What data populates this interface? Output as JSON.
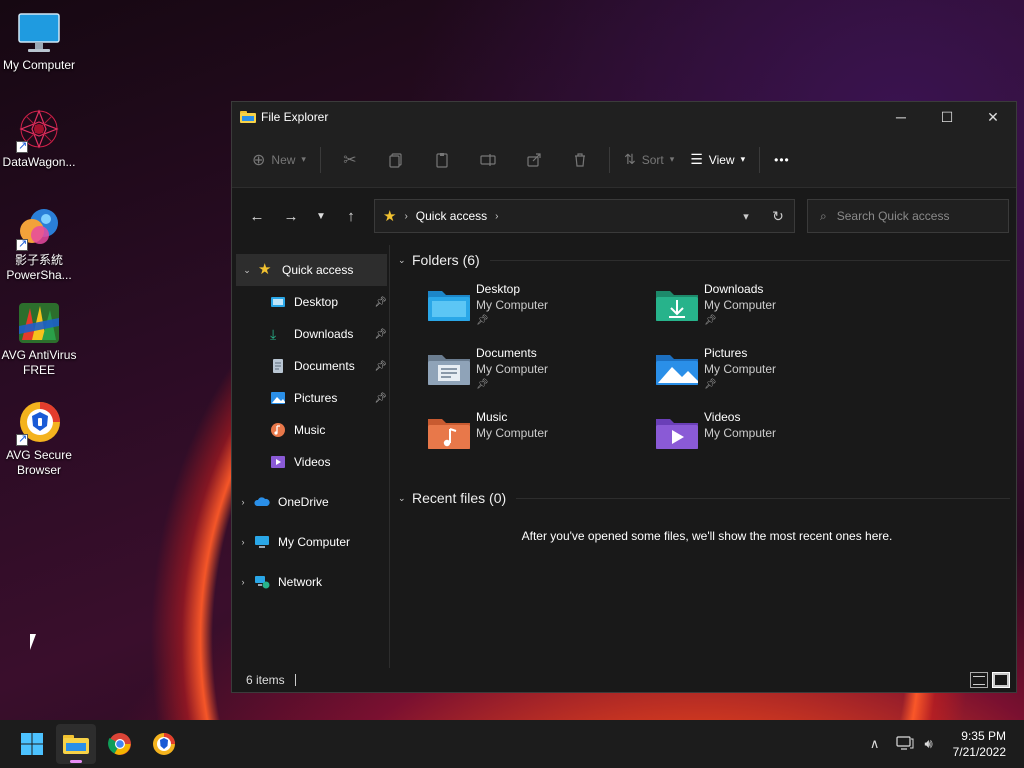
{
  "desktop": {
    "icons": [
      {
        "label": "My Computer",
        "icon": "monitor-icon"
      },
      {
        "label": "DataWagon...",
        "icon": "datawagon-icon"
      },
      {
        "label": "影子系統 PowerSha...",
        "icon": "powershadow-icon"
      },
      {
        "label": "AVG AntiVirus FREE",
        "icon": "avg-antivirus-icon"
      },
      {
        "label": "AVG Secure Browser",
        "icon": "avg-browser-icon"
      }
    ]
  },
  "window": {
    "title": "File Explorer",
    "controls": {
      "minimize": "─",
      "maximize": "☐",
      "close": "✕"
    },
    "toolbar": {
      "new_label": "New",
      "sort_label": "Sort",
      "view_label": "View",
      "more_label": "•••"
    },
    "address": {
      "crumb": "Quick access"
    },
    "search": {
      "placeholder": "Search Quick access"
    },
    "sidebar": {
      "quick_access": "Quick access",
      "pinned": [
        {
          "label": "Desktop",
          "pinned": true
        },
        {
          "label": "Downloads",
          "pinned": true
        },
        {
          "label": "Documents",
          "pinned": true
        },
        {
          "label": "Pictures",
          "pinned": true
        },
        {
          "label": "Music",
          "pinned": false
        },
        {
          "label": "Videos",
          "pinned": false
        }
      ],
      "onedrive": "OneDrive",
      "my_computer": "My Computer",
      "network": "Network"
    },
    "folders_section": "Folders (6)",
    "folders": [
      {
        "name": "Desktop",
        "location": "My Computer",
        "pinned": true,
        "color": "#2aa7e8"
      },
      {
        "name": "Downloads",
        "location": "My Computer",
        "pinned": true,
        "color": "#27b38b"
      },
      {
        "name": "Documents",
        "location": "My Computer",
        "pinned": true,
        "color": "#8fa3b8"
      },
      {
        "name": "Pictures",
        "location": "My Computer",
        "pinned": true,
        "color": "#2a8fe8"
      },
      {
        "name": "Music",
        "location": "My Computer",
        "pinned": false,
        "color": "#e8784a"
      },
      {
        "name": "Videos",
        "location": "My Computer",
        "pinned": false,
        "color": "#8a5ad6"
      }
    ],
    "recent_section": "Recent files (0)",
    "recent_message": "After you've opened some files, we'll show the most recent ones here.",
    "status": {
      "items": "6 items"
    }
  },
  "taskbar": {
    "time": "9:35 PM",
    "date": "7/21/2022"
  },
  "colors": {
    "window_bg": "#191919",
    "toolbar_bg": "#202020",
    "taskbar_bg": "#1c1c1c",
    "accent": "#e98df5"
  }
}
